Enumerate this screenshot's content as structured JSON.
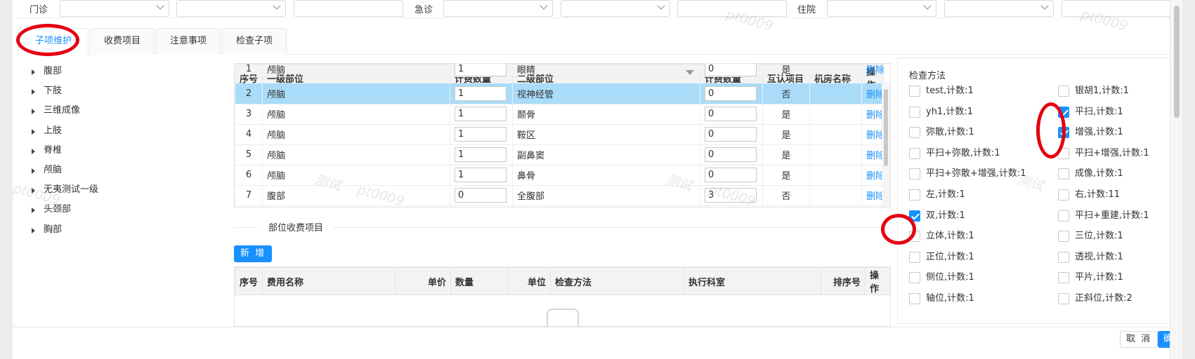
{
  "filters": [
    {
      "label": "门诊",
      "select1": "",
      "select2": "",
      "input": ""
    },
    {
      "label": "急诊",
      "select1": "",
      "select2": "",
      "input": ""
    },
    {
      "label": "住院",
      "select1": "",
      "select2": "",
      "input": ""
    }
  ],
  "tabs": [
    "子项维护",
    "收费项目",
    "注意事项",
    "检查子项"
  ],
  "active_tab": "子项维护",
  "tree": [
    "腹部",
    "下肢",
    "三维成像",
    "上肢",
    "脊椎",
    "颅脑",
    "无夷测试一级",
    "头颈部",
    "胸部"
  ],
  "sub_grid": {
    "headers": [
      "序号",
      "一级部位",
      "计费数量",
      "二级部位",
      "计费数量",
      "互认项目",
      "机房名称",
      "操作"
    ],
    "rows": [
      {
        "no": "1",
        "level1": "颅脑",
        "qty1": "1",
        "level2": "眼睛",
        "qty2": "0",
        "mutual": "是",
        "room": "",
        "op": "删除"
      },
      {
        "no": "2",
        "level1": "颅脑",
        "qty1": "1",
        "level2": "视神经管",
        "qty2": "0",
        "mutual": "否",
        "room": "",
        "op": "删除",
        "selected": true
      },
      {
        "no": "3",
        "level1": "颅脑",
        "qty1": "1",
        "level2": "颞骨",
        "qty2": "0",
        "mutual": "是",
        "room": "",
        "op": "删除"
      },
      {
        "no": "4",
        "level1": "颅脑",
        "qty1": "1",
        "level2": "鞍区",
        "qty2": "0",
        "mutual": "是",
        "room": "",
        "op": "删除"
      },
      {
        "no": "5",
        "level1": "颅脑",
        "qty1": "1",
        "level2": "副鼻窦",
        "qty2": "0",
        "mutual": "是",
        "room": "",
        "op": "删除"
      },
      {
        "no": "6",
        "level1": "颅脑",
        "qty1": "1",
        "level2": "鼻骨",
        "qty2": "0",
        "mutual": "是",
        "room": "",
        "op": "删除"
      },
      {
        "no": "7",
        "level1": "腹部",
        "qty1": "0",
        "level2": "全腹部",
        "qty2": "3",
        "mutual": "否",
        "room": "",
        "op": "删除"
      }
    ]
  },
  "fee_section": {
    "title": "部位收费项目",
    "add_button": "新 增",
    "headers": [
      "序号",
      "费用名称",
      "单价",
      "数量",
      "单位",
      "检查方法",
      "执行科室",
      "排序号",
      "操作"
    ]
  },
  "methods": {
    "title": "检查方法",
    "left": [
      {
        "label": "test,计数:1",
        "checked": false
      },
      {
        "label": "yh1,计数:1",
        "checked": false
      },
      {
        "label": "弥散,计数:1",
        "checked": false
      },
      {
        "label": "平扫+弥散,计数:1",
        "checked": false
      },
      {
        "label": "平扫+弥散+增强,计数:1",
        "checked": false
      },
      {
        "label": "左,计数:1",
        "checked": false
      },
      {
        "label": "双,计数:1",
        "checked": true
      },
      {
        "label": "立体,计数:1",
        "checked": false
      },
      {
        "label": "正位,计数:1",
        "checked": false
      },
      {
        "label": "侧位,计数:1",
        "checked": false
      },
      {
        "label": "轴位,计数:1",
        "checked": false
      }
    ],
    "right": [
      {
        "label": "银胡1,计数:1",
        "checked": false
      },
      {
        "label": "平扫,计数:1",
        "checked": true
      },
      {
        "label": "增强,计数:1",
        "checked": true
      },
      {
        "label": "平扫+增强,计数:1",
        "checked": false
      },
      {
        "label": "成像,计数:1",
        "checked": false
      },
      {
        "label": "右,计数:11",
        "checked": false
      },
      {
        "label": "平扫+重建,计数:1",
        "checked": false
      },
      {
        "label": "三位,计数:1",
        "checked": false
      },
      {
        "label": "透视,计数:1",
        "checked": false
      },
      {
        "label": "平片,计数:1",
        "checked": false
      },
      {
        "label": "正斜位,计数:2",
        "checked": false
      }
    ]
  },
  "footer": {
    "cancel": "取 消",
    "ok": "确 定"
  },
  "watermark": {
    "a": "测试",
    "b": "pt0009"
  },
  "colors": {
    "accent": "#1890ff",
    "selected_row": "#a9dcf8",
    "annotation": "#e3000f"
  }
}
